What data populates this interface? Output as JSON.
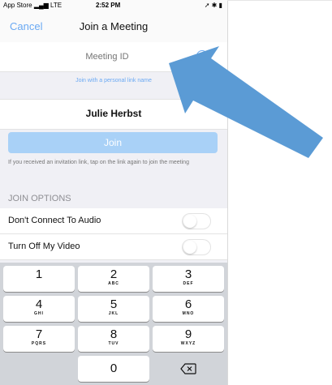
{
  "status_bar": {
    "carrier": "App Store",
    "network": "LTE",
    "time": "2:52 PM"
  },
  "nav": {
    "cancel_label": "Cancel",
    "title": "Join a Meeting"
  },
  "meeting": {
    "placeholder": "Meeting ID",
    "personal_link_text": "Join with a personal link name"
  },
  "user": {
    "name": "Julie Herbst"
  },
  "join_button": {
    "label": "Join"
  },
  "invite_note": "If you received an invitation link, tap on the link again to join the meeting",
  "join_options": {
    "header": "JOIN OPTIONS",
    "options": [
      {
        "label": "Don't Connect To Audio",
        "enabled": false
      },
      {
        "label": "Turn Off My Video",
        "enabled": false
      }
    ]
  },
  "keypad": {
    "keys": [
      {
        "num": "1",
        "letters": ""
      },
      {
        "num": "2",
        "letters": "ABC"
      },
      {
        "num": "3",
        "letters": "DEF"
      },
      {
        "num": "4",
        "letters": "GHI"
      },
      {
        "num": "5",
        "letters": "JKL"
      },
      {
        "num": "6",
        "letters": "MNO"
      },
      {
        "num": "7",
        "letters": "PQRS"
      },
      {
        "num": "8",
        "letters": "TUV"
      },
      {
        "num": "9",
        "letters": "WXYZ"
      },
      {
        "num": "0",
        "letters": ""
      }
    ],
    "delete_icon": "backspace-icon"
  },
  "colors": {
    "accent": "#6aa9f3",
    "join_button": "#a9d1f7",
    "annotation_arrow": "#5b9bd5"
  }
}
